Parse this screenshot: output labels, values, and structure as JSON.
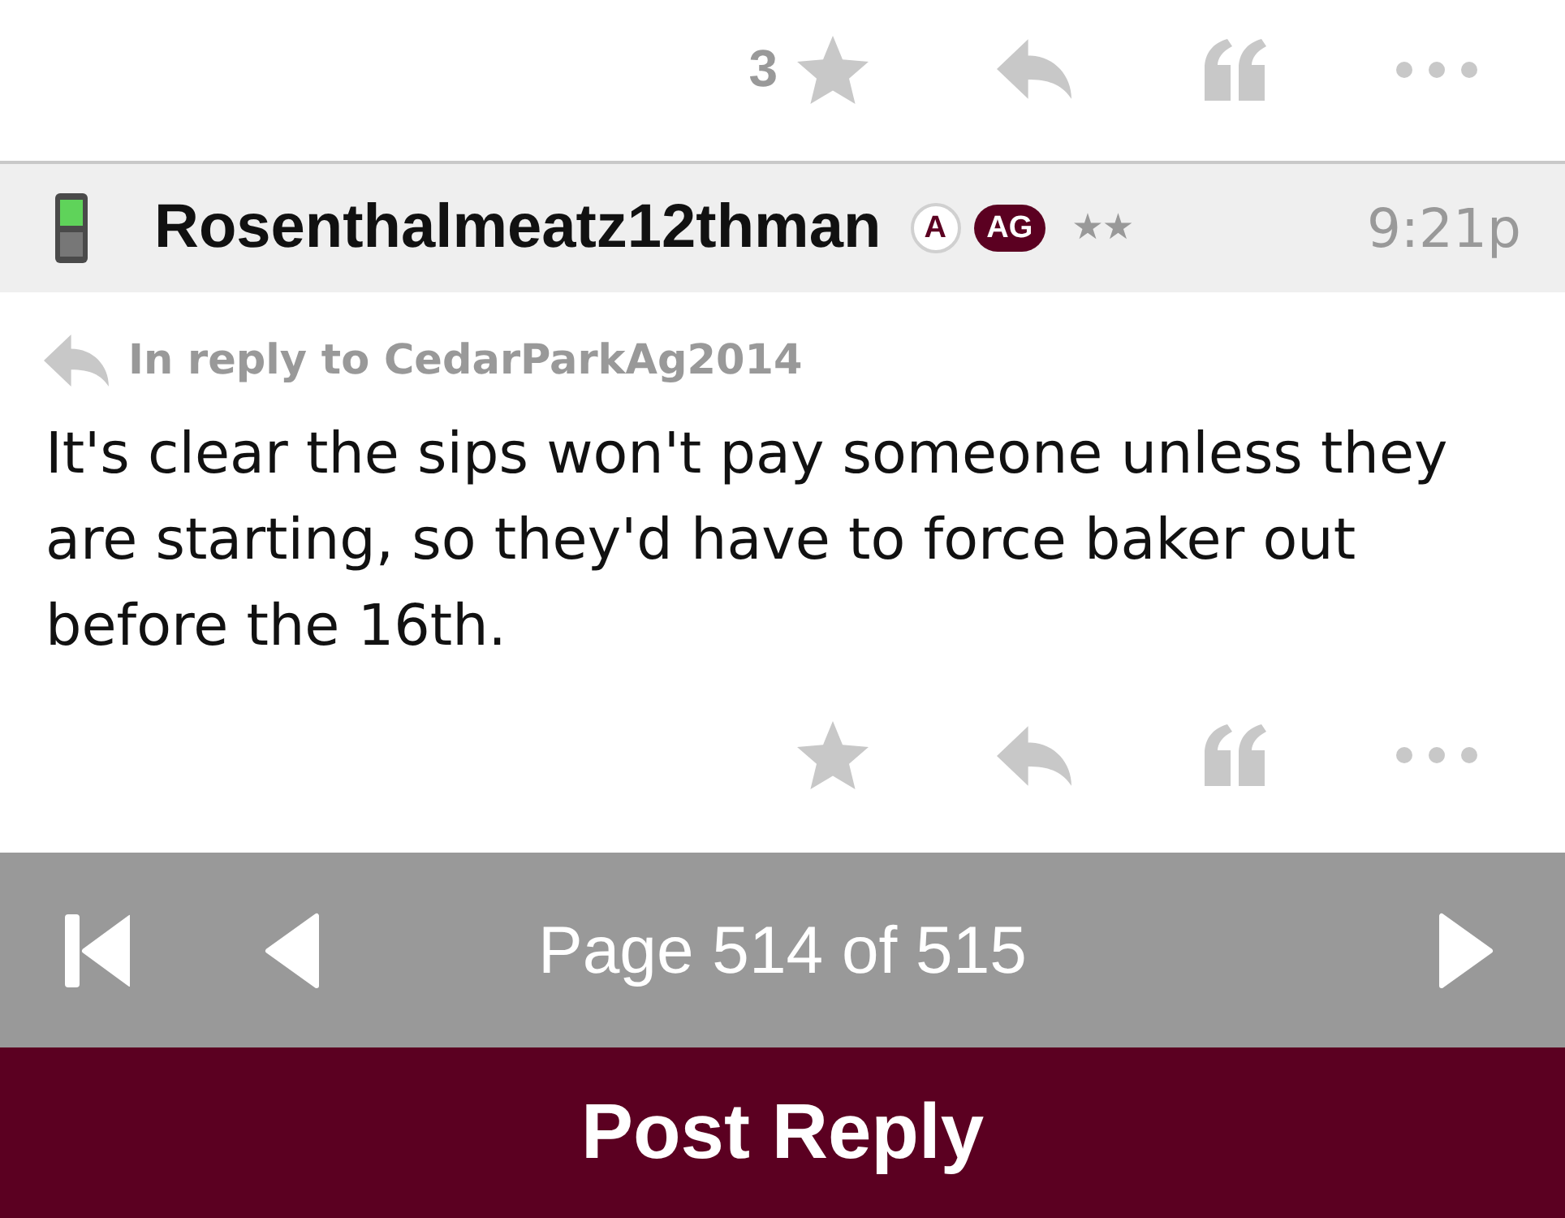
{
  "previous_post_actions": {
    "star_count": "3"
  },
  "post": {
    "author": "Rosenthalmeatz12thman",
    "badges": [
      {
        "kind": "circle",
        "label": "A"
      },
      {
        "kind": "pill",
        "label": "AG"
      }
    ],
    "rank": "★★",
    "time": "9:21p",
    "in_reply_to": "In reply to CedarParkAg2014",
    "body": "It's clear the sips won't pay someone unless they are starting, so they'd have to force baker out before the 16th."
  },
  "pager": {
    "label": "Page 514 of 515"
  },
  "post_reply_button": {
    "label": "Post Reply"
  }
}
